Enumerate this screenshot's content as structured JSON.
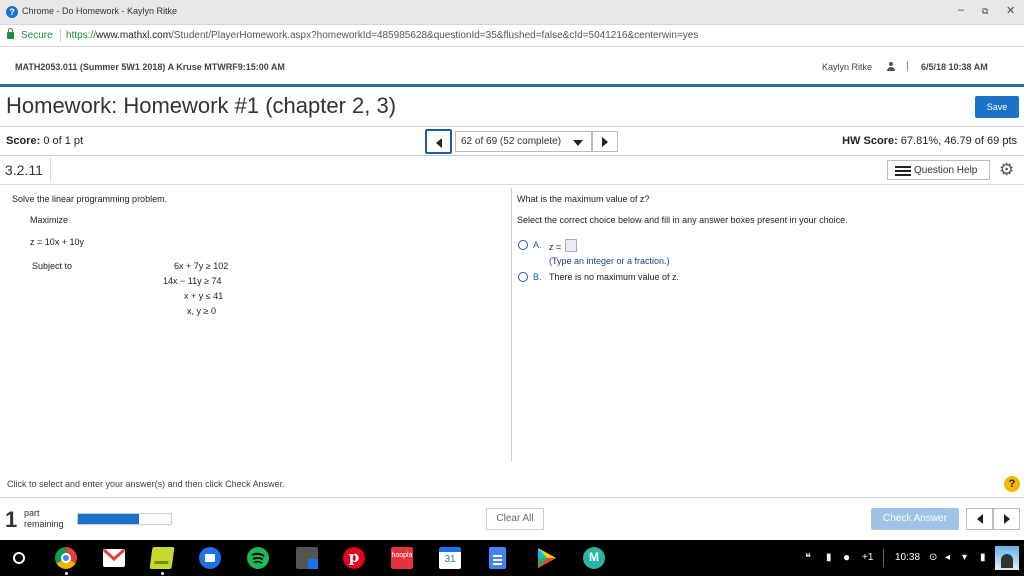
{
  "window": {
    "title": "Chrome - Do Homework - Kaylyn Ritke",
    "app_icon": "?",
    "minimize": "–",
    "restore": "⧉",
    "close": "✕"
  },
  "address": {
    "secure_label": "Secure",
    "url_scheme": "https://",
    "url_host": "www.mathxl.com",
    "url_path": "/Student/PlayerHomework.aspx?homeworkId=485985628&questionId=35&flushed=false&cId=5041216&centerwin=yes"
  },
  "course": {
    "name": "MATH2053.011 (Summer 5W1 2018) A Kruse MTWRF9:15:00 AM",
    "user": "Kaylyn Ritke",
    "separator": "|",
    "datetime": "6/5/18 10:38 AM"
  },
  "homework": {
    "title": "Homework: Homework #1 (chapter 2, 3)",
    "save_label": "Save"
  },
  "score_row": {
    "score_label": "Score:",
    "score_value": "0 of 1 pt",
    "nav_text": "62 of 69 (52 complete)",
    "hw_score_label": "HW Score:",
    "hw_score_value": "67.81%, 46.79 of 69 pts"
  },
  "question": {
    "number": "3.2.11",
    "help_label": "Question Help"
  },
  "problem": {
    "intro": "Solve the linear programming problem.",
    "maximize": "Maximize",
    "objective": "z = 10x + 10y",
    "subject_to": "Subject to",
    "constraints": [
      "6x + 7y  ≥  102",
      "14x − 11y  ≥  74",
      "x + y  ≤  41",
      "x, y  ≥  0"
    ]
  },
  "answer": {
    "question": "What is the maximum value of z?",
    "instruction": "Select the correct choice below and fill in any answer boxes present in your choice.",
    "choice_a_letter": "A.",
    "choice_a_text": "z =",
    "choice_a_hint": "(Type an integer or a fraction.)",
    "choice_b_letter": "B.",
    "choice_b_text": "There is no maximum value of z."
  },
  "footer": {
    "instruction": "Click to select and enter your answer(s) and then click Check Answer.",
    "help_icon": "?",
    "parts_count": "1",
    "parts_word1": "part",
    "parts_word2": "remaining",
    "progress_fraction": 0.66,
    "clear_label": "Clear All",
    "check_label": "Check Answer"
  },
  "taskbar": {
    "apps": [
      {
        "name": "chrome",
        "label": ""
      },
      {
        "name": "gmail",
        "label": ""
      },
      {
        "name": "google-keep",
        "label": ""
      },
      {
        "name": "files",
        "label": ""
      },
      {
        "name": "spotify",
        "label": ""
      },
      {
        "name": "calculator",
        "label": ""
      },
      {
        "name": "pinterest",
        "label": ""
      },
      {
        "name": "hoopla",
        "label": "hoopla"
      },
      {
        "name": "calendar",
        "label": "31"
      },
      {
        "name": "docs",
        "label": ""
      },
      {
        "name": "play-store",
        "label": ""
      },
      {
        "name": "mathxl",
        "label": "M"
      }
    ],
    "notification_count": "+1",
    "time": "10:38"
  },
  "colors": {
    "accent": "#1a73c9",
    "header_rule": "#2d6a9f",
    "secure_green": "#1e8e3e"
  }
}
